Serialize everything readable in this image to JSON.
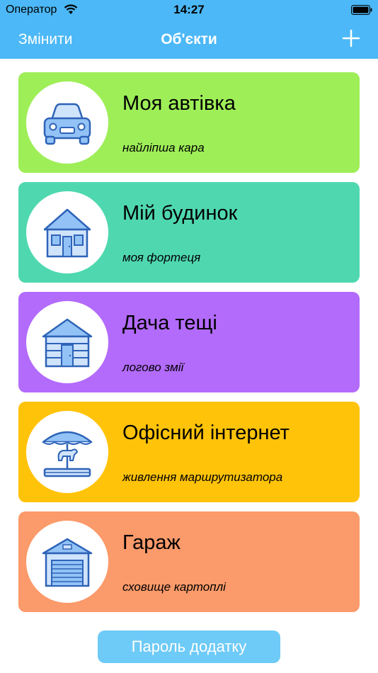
{
  "status_bar": {
    "carrier": "Оператор",
    "time": "14:27"
  },
  "nav": {
    "left": "Змінити",
    "title": "Об'єкти",
    "add_icon": "plus-icon"
  },
  "objects": [
    {
      "title": "Моя автівка",
      "subtitle": "найліпша кара",
      "icon": "car-icon",
      "color": "#9eee58"
    },
    {
      "title": "Мій будинок",
      "subtitle": "моя фортеця",
      "icon": "house-icon",
      "color": "#4fd8b0"
    },
    {
      "title": "Дача тещі",
      "subtitle": "логово змії",
      "icon": "log-cabin-icon",
      "color": "#b36bfb"
    },
    {
      "title": "Офісний інтернет",
      "subtitle": "живлення маршрутизатора",
      "icon": "carousel-icon",
      "color": "#ffc30a"
    },
    {
      "title": "Гараж",
      "subtitle": "сховище картоплі",
      "icon": "garage-icon",
      "color": "#fb9a6a"
    }
  ],
  "footer": {
    "password_button": "Пароль додатку"
  },
  "colors": {
    "header": "#4cb8f7",
    "button": "#6ecaf6"
  }
}
